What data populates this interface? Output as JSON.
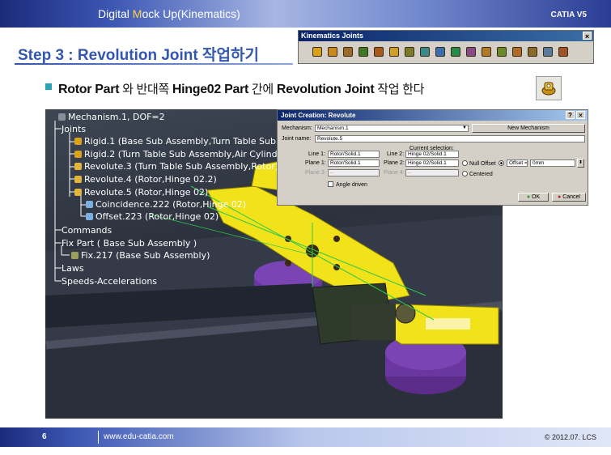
{
  "header": {
    "title_pre": "Digital ",
    "title_m": "M",
    "title_post": "ock Up(Kinematics)",
    "brand": "CATIA V5"
  },
  "step": {
    "title": "Step 3 : Revolution Joint 작업하기"
  },
  "toolbar": {
    "title": "Kinematics Joints",
    "close": "×",
    "icons": [
      "revolute-joint",
      "prismatic-joint",
      "cylindrical-joint",
      "screw-joint",
      "spherical-joint",
      "planar-joint",
      "rigid-joint",
      "point-curve-joint",
      "slide-curve-joint",
      "roll-curve-joint",
      "point-surface-joint",
      "universal-joint",
      "cv-joint",
      "gear-joint",
      "rack-joint",
      "cable-joint",
      "axis-system-joint"
    ],
    "icon_colors": [
      "#d8a21a",
      "#c88b1c",
      "#9b6b2a",
      "#3c7a2a",
      "#a85a1a",
      "#cfa02a",
      "#7a7a2a",
      "#3a8a8a",
      "#3a6ab0",
      "#2a8a4a",
      "#8a4a8a",
      "#b07a2a",
      "#6a8a2a",
      "#b06a2a",
      "#8a6a2a",
      "#5a7aa0",
      "#a0502a"
    ]
  },
  "instruction": {
    "part1": "Rotor Part",
    "k1": " 와 반대쪽 ",
    "part2": "Hinge02 Part",
    "k2": " 간에 ",
    "part3": "Revolution Joint",
    "k3": " 작업 한다"
  },
  "tree": {
    "root": "Mechanism.1, DOF=2",
    "joints": "Joints",
    "items": [
      "Rigid.1 (Base Sub Assembly,Turn Table Sub A",
      "Rigid.2 (Turn Table Sub Assembly,Air Cylinder",
      "Revolute.3 (Turn Table Sub Assembly,Rotor)",
      "Revolute.4 (Rotor,Hinge 02.2)",
      "Revolute.5 (Rotor,Hinge 02)",
      "Coincidence.222 (Rotor,Hinge 02)",
      "Offset.223 (Rotor,Hinge 02)"
    ],
    "commands": "Commands",
    "fix_part": "Fix Part ( Base Sub Assembly )",
    "fix": "Fix.217 (Base Sub Assembly)",
    "laws": "Laws",
    "speeds": "Speeds-Accelerations"
  },
  "dialog": {
    "title": "Joint Creation: Revolute",
    "help": "?",
    "close": "×",
    "mechanism_label": "Mechanism:",
    "mechanism_value": "Mechanism.1",
    "new_mechanism": "New Mechanism",
    "joint_name_label": "Joint name:",
    "joint_name_value": "Revolute.5",
    "current_selection": "Current selection:",
    "line1_label": "Line 1:",
    "line1_value": "Rotor/Solid.1",
    "line2_label": "Line 2:",
    "line2_value": "Hinge 02/Solid.1",
    "plane1_label": "Plane 1:",
    "plane1_value": "Rotor/Solid.1",
    "plane2_label": "Plane 2:",
    "plane2_value": "Hinge 02/Solid.1",
    "plane3_label": "Plane 3:",
    "plane3_value": "--",
    "plane4_label": "Plane 4:",
    "plane4_value": "--",
    "null_offset": "Null Offset",
    "offset_option": "Offset =",
    "offset_value": "0mm",
    "centered": "Centered",
    "angle_driven": "Angle driven",
    "ok": "OK",
    "cancel": "Cancel"
  },
  "footer": {
    "page": "6",
    "url": "www.edu-catia.com",
    "copyright": "© 2012.07. LCS"
  }
}
